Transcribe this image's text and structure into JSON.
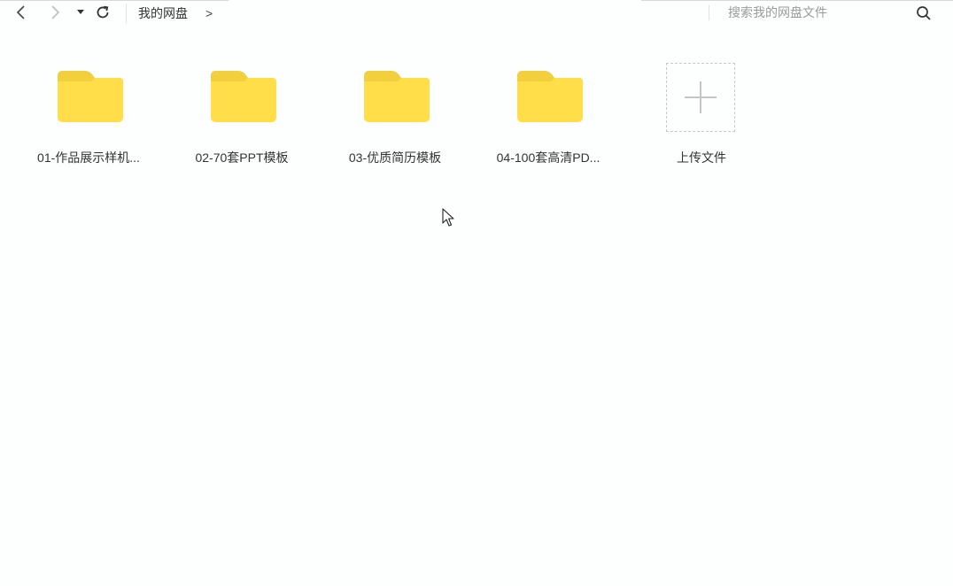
{
  "toolbar": {
    "back_icon": "chevron-left-icon",
    "forward_icon": "chevron-right-icon",
    "history_icon": "caret-down-icon",
    "refresh_icon": "refresh-icon"
  },
  "breadcrumb": {
    "root": "我的网盘",
    "separator": ">"
  },
  "search": {
    "placeholder": "搜索我的网盘文件",
    "value": "",
    "icon": "search-icon"
  },
  "folders": [
    {
      "name": "01-作品展示样机..."
    },
    {
      "name": "02-70套PPT模板"
    },
    {
      "name": "03-优质简历模板"
    },
    {
      "name": "04-100套高清PD..."
    }
  ],
  "upload": {
    "label": "上传文件",
    "icon": "plus-icon"
  },
  "colors": {
    "folder": "#ffde4a",
    "folder_tab": "#f9d23c",
    "background": "#fdfefe"
  }
}
